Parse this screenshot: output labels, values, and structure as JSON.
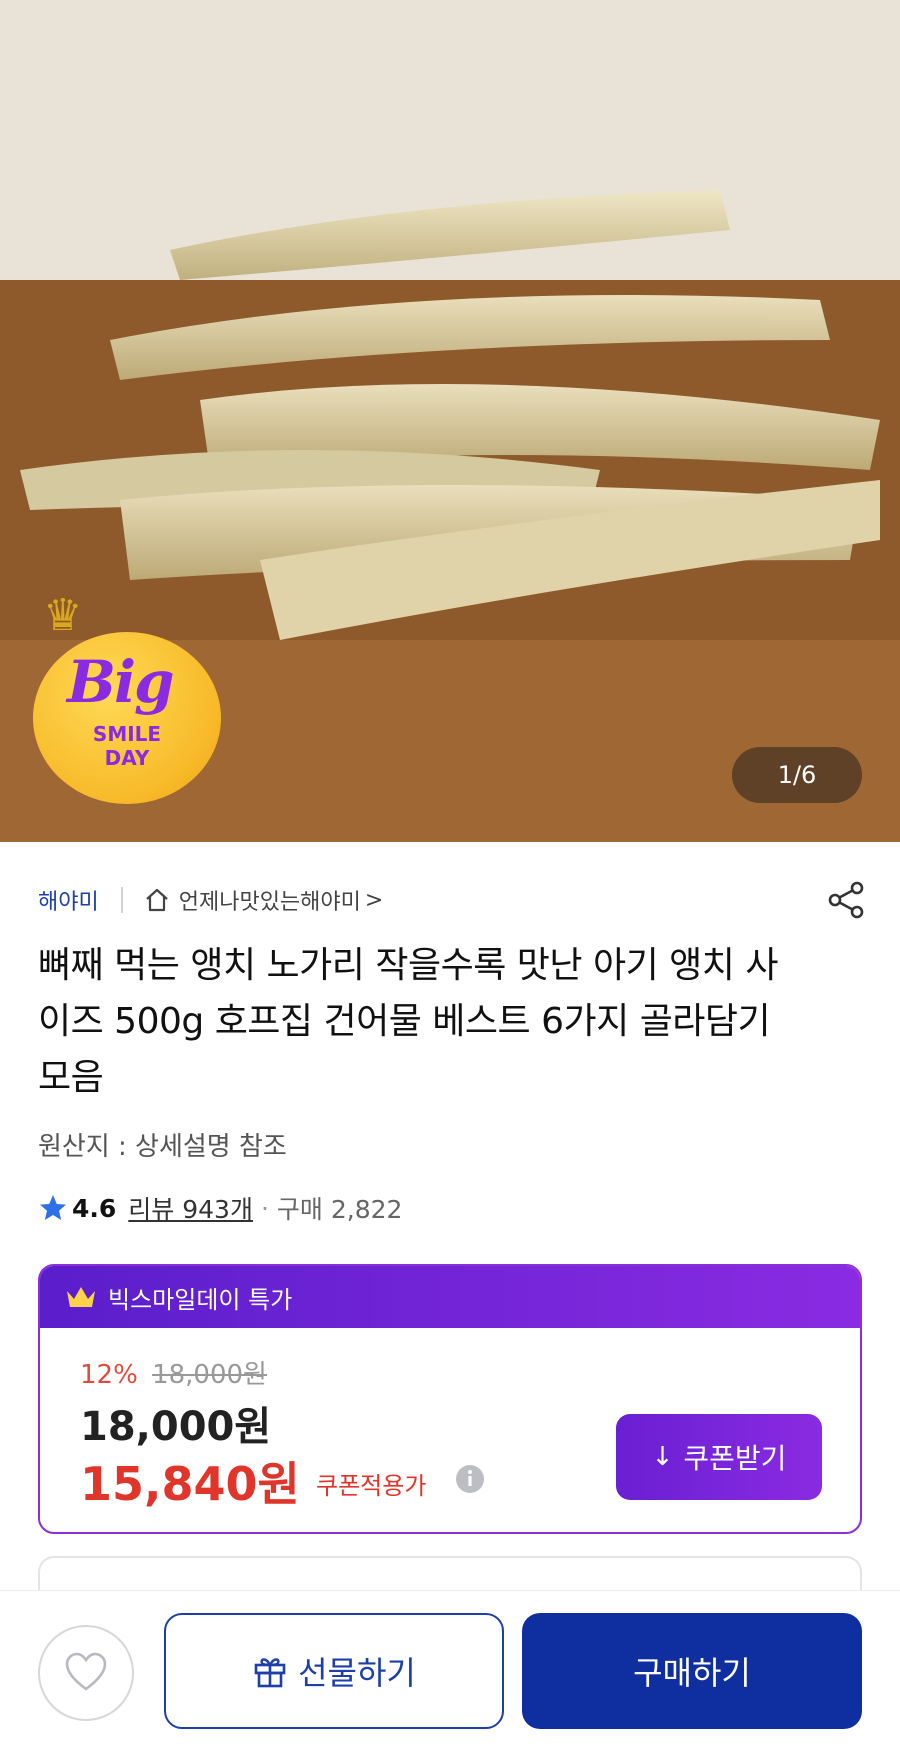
{
  "hero": {
    "badge": {
      "big": "Big",
      "smile": "SMILE",
      "day": "DAY"
    },
    "pager": "1/6"
  },
  "store": {
    "brand": "해야미",
    "store_name": "언제나맛있는해야미",
    "chevron": ">"
  },
  "product": {
    "title": "뼈째 먹는 앵치 노가리 작을수록 맛난 아기 앵치 사이즈 500g 호프집 건어물 베스트 6가지 골라담기 모음",
    "origin": "원산지 : 상세설명 참조",
    "rating": "4.6",
    "reviews": "리뷰 943개",
    "dot": "·",
    "purchases": "구매 2,822"
  },
  "price": {
    "header": "빅스마일데이 특가",
    "discount": "12%",
    "original": "18,000원",
    "sale": "18,000원",
    "coupon_price": "15,840원",
    "coupon_note": "쿠폰적용가",
    "coupon_button": "쿠폰받기"
  },
  "bottom": {
    "gift": "선물하기",
    "buy": "구매하기"
  },
  "colors": {
    "brand_blue": "#1c3faa",
    "purple": "#8a2be2",
    "price_red": "#e0352b",
    "buy_blue": "#0f2fa0"
  },
  "icons": [
    "home-icon",
    "share-icon",
    "star-icon",
    "crown-icon",
    "info-icon",
    "download-icon",
    "heart-icon",
    "gift-icon"
  ]
}
